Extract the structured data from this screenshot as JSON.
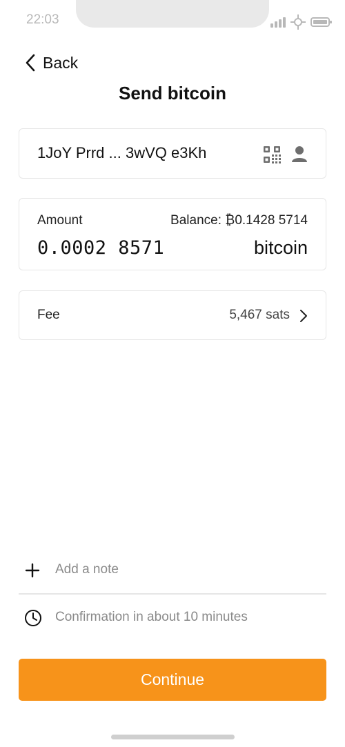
{
  "status_bar": {
    "time": "22:03",
    "icons": [
      "signal-icon",
      "connectivity-icon",
      "battery-icon"
    ]
  },
  "header": {
    "back_label": "Back",
    "title": "Send bitcoin"
  },
  "address": {
    "value": "1JoY Prrd ... 3wVQ e3Kh",
    "icons": [
      "qr-code-icon",
      "contact-icon"
    ]
  },
  "amount": {
    "label": "Amount",
    "balance": "Balance: ₿0.1428 5714",
    "value": "0.0002 8571",
    "unit": "bitcoin"
  },
  "fee": {
    "label": "Fee",
    "value": "5,467 sats"
  },
  "note": {
    "label": "Add a note"
  },
  "confirmation": {
    "label": "Confirmation in about 10 minutes"
  },
  "actions": {
    "continue_label": "Continue"
  },
  "colors": {
    "accent": "#f7931a",
    "border": "#e6e6e6",
    "muted_text": "#8a8a8a"
  }
}
